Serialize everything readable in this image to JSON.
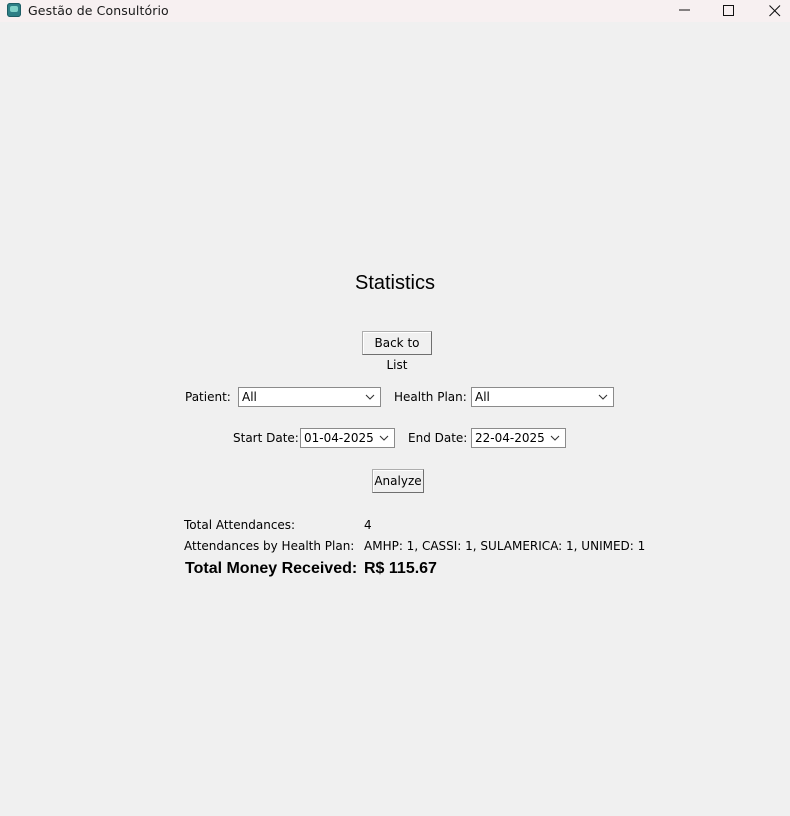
{
  "window": {
    "title": "Gestão de Consultório",
    "icon": "app-icon"
  },
  "page": {
    "title": "Statistics",
    "back_button": "Back to List",
    "analyze_button": "Analyze"
  },
  "filters": {
    "patient_label": "Patient:",
    "patient_value": "All",
    "health_plan_label": "Health Plan:",
    "health_plan_value": "All",
    "start_date_label": "Start Date:",
    "start_date_value": "01-04-2025",
    "end_date_label": "End Date:",
    "end_date_value": "22-04-2025"
  },
  "results": {
    "total_attendances_label": "Total Attendances:",
    "total_attendances_value": "4",
    "by_plan_label": "Attendances by Health Plan:",
    "by_plan_value": "AMHP: 1, CASSI: 1, SULAMERICA: 1, UNIMED: 1",
    "money_label": "Total Money Received:",
    "money_value": "R$ 115.67"
  }
}
